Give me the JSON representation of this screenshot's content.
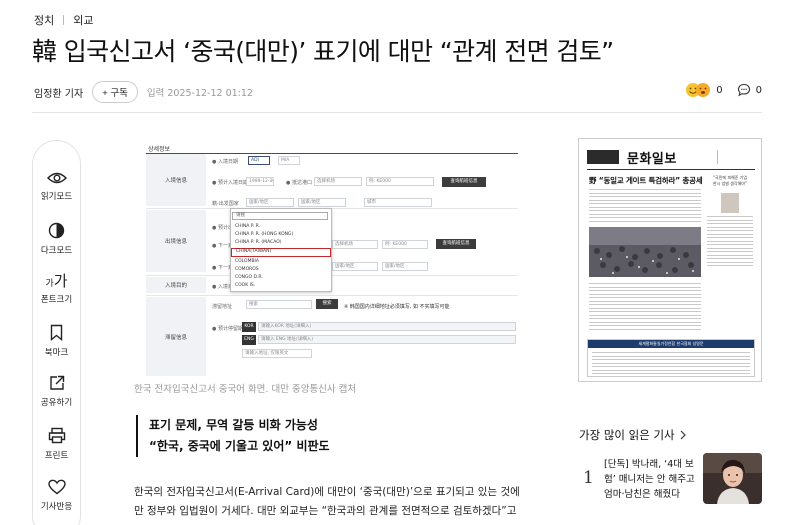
{
  "breadcrumb": {
    "section": "정치",
    "subsection": "외교"
  },
  "article": {
    "title": "韓 입국신고서 ‘중국(대만)’ 표기에 대만 “관계 전면 검토”",
    "author": "임정환 기자",
    "subscribe_label": "+ 구독",
    "date": "입력 2025-12-12 01:12",
    "reaction_count": "0",
    "comment_count": "0",
    "image_caption": "한국 전자입국신고서 중국어 화면. 대만 중앙통신사 캡처",
    "quote_line1": "표기 문제, 무역 갈등 비화 가능성",
    "quote_line2": "“한국, 중국에 기울고 있어” 비판도",
    "body_line1": "한국의 전자입국신고서(E-Arrival Card)에 대만이 ‘중국(대만)’으로 표기되고 있는 것에 대해 대",
    "body_line2": "만 정부와 입법원이 거세다. 대만 외교부는 “한국과의 관계를 전면적으로 검토하겠다”고 경고하며"
  },
  "tools": [
    {
      "label": "읽기모드",
      "icon": "eye-icon"
    },
    {
      "label": "다크모드",
      "icon": "contrast-icon"
    },
    {
      "label": "폰트크기",
      "icon": "font-size-icon"
    },
    {
      "label": "북마크",
      "icon": "bookmark-icon"
    },
    {
      "label": "공유하기",
      "icon": "share-icon"
    },
    {
      "label": "프린트",
      "icon": "print-icon"
    },
    {
      "label": "기사반응",
      "icon": "heart-icon"
    }
  ],
  "font_glyphs": {
    "small": "가",
    "large": "가"
  },
  "form_shot": {
    "header": "상세정보",
    "label_entry": "入境信息",
    "label_exit": "出境信息",
    "label_stay": "入境目的",
    "label_other": "滞留信息",
    "f_date": "入境日期",
    "f_flight": "预计入境日期",
    "f_airport": "抵达港口",
    "f_country": "籍-出发国家",
    "f_depart": "预计出境日期",
    "f_next": "下一目的地",
    "f_purpose": "入境目的",
    "f_address": "滞留地址",
    "f_phone": "预计停留期间",
    "tab_arrival": "ADI",
    "tab_korea": "MIA",
    "v_date": "1999-12-30",
    "v_airport": "选择机场",
    "v_flight": "例: KE000",
    "v_select": "国家/地区",
    "v_search": "搜索",
    "v_city": "城市",
    "btn_find_flight": "查询航班信息",
    "btn_find_flight2": "查询航班信息",
    "btn_search": "搜索",
    "kor_badge": "KOR",
    "eng_badge": "ENG",
    "kor_hint": "请输入KOR 地址(详细入)",
    "eng_hint": "请输入 ENG 地址(详细入)",
    "addr_hint": "请输入地址, 仅限英文",
    "note": "※ 韩国国内详细地址必须填写, 如 不实填写可能",
    "dropdown_search": "请搜",
    "options": [
      "CHINA P. R.",
      "CHINA P. R. (HONG KONG)",
      "CHINA P. R. (MACAO)",
      "CHINA(TAIWAN)",
      "COLOMBIA",
      "COMOROS",
      "CONGO D.R.",
      "COOK IS."
    ],
    "highlight_index": 3
  },
  "newspaper": {
    "name": "문화일보",
    "headline": "野 “동일교 게이트 특검하라” 총공세",
    "ad_banner": "세계평화통일가정연합 한국협회 성명문",
    "side_note1": "“국민에 피해준 기업",
    "side_note2": "한시 엄벌 생각해야”"
  },
  "popular": {
    "title": "가장 많이 읽은 기사",
    "items": [
      {
        "rank": "1",
        "line1": "[단독] 박나래, ‘4대 보",
        "line2": "험’ 매니저는 안 해주고",
        "line3": "엄마·남친은 해줬다"
      }
    ]
  },
  "colors": {
    "highlight_red": "#c6282f",
    "form_navy": "#3a4c7a",
    "ad_blue": "#1e3b6e"
  }
}
